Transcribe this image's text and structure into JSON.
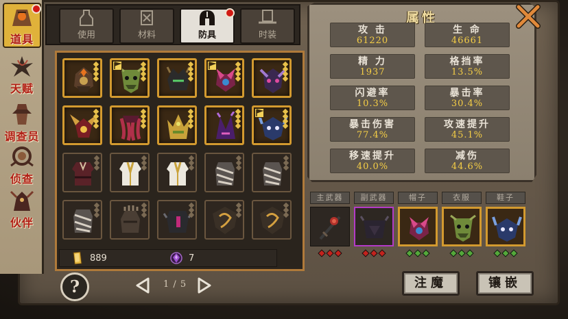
{
  "side_nav": [
    {
      "key": "props",
      "label": "道具",
      "active": true,
      "badge": true
    },
    {
      "key": "talent",
      "label": "天赋",
      "active": false,
      "badge": false
    },
    {
      "key": "investigator",
      "label": "调查员",
      "active": false,
      "badge": false
    },
    {
      "key": "detective",
      "label": "侦查",
      "active": false,
      "badge": false
    },
    {
      "key": "partner",
      "label": "伙伴",
      "active": false,
      "badge": false
    }
  ],
  "tabs": [
    {
      "key": "use",
      "label": "使用",
      "active": false,
      "badge": false
    },
    {
      "key": "material",
      "label": "材料",
      "active": false,
      "badge": false
    },
    {
      "key": "armor",
      "label": "防具",
      "active": true,
      "badge": true
    },
    {
      "key": "fashion",
      "label": "时装",
      "active": false,
      "badge": false
    }
  ],
  "inventory": [
    {
      "frame": "gold",
      "art": "flame-helm",
      "flag": false,
      "stars": 4
    },
    {
      "frame": "gold",
      "art": "green-mask",
      "flag": true,
      "stars": 4
    },
    {
      "frame": "gold",
      "art": "spike-helm",
      "flag": false,
      "stars": 4
    },
    {
      "frame": "gold",
      "art": "crest-helm",
      "flag": true,
      "stars": 4
    },
    {
      "frame": "gold",
      "art": "purple-demon",
      "flag": false,
      "stars": 4
    },
    {
      "frame": "gold",
      "art": "horned-red",
      "flag": false,
      "stars": 4
    },
    {
      "frame": "gold",
      "art": "tentacle-red",
      "flag": false,
      "stars": 4
    },
    {
      "frame": "gold",
      "art": "gold-crown",
      "flag": false,
      "stars": 4
    },
    {
      "frame": "gold",
      "art": "purple-claw",
      "flag": false,
      "stars": 4
    },
    {
      "frame": "gold",
      "art": "blue-beast",
      "flag": true,
      "stars": 4
    },
    {
      "frame": "brown",
      "art": "red-robe",
      "flag": false,
      "stars": 3
    },
    {
      "frame": "brown",
      "art": "white-robe",
      "flag": false,
      "stars": 3
    },
    {
      "frame": "brown",
      "art": "white-robe",
      "flag": false,
      "stars": 3
    },
    {
      "frame": "brown",
      "art": "strap-vest",
      "flag": false,
      "stars": 3
    },
    {
      "frame": "brown",
      "art": "strap-vest",
      "flag": false,
      "stars": 3
    },
    {
      "frame": "brown",
      "art": "strap-vest",
      "flag": false,
      "stars": 3
    },
    {
      "frame": "brown",
      "art": "dark-gauntlet",
      "flag": false,
      "stars": 3
    },
    {
      "frame": "brown",
      "art": "black-armor",
      "flag": false,
      "stars": 3
    },
    {
      "frame": "brown",
      "art": "gold-shield",
      "flag": false,
      "stars": 3
    },
    {
      "frame": "brown",
      "art": "gold-shield",
      "flag": false,
      "stars": 3
    }
  ],
  "currency": {
    "gold_icon": "gold-bar-icon",
    "gold_amount": "889",
    "gem_icon": "purple-gem-icon",
    "gem_amount": "7"
  },
  "pagination": {
    "help_label": "?",
    "page_text": "1 / 5",
    "current": 1,
    "total": 5
  },
  "attributes": {
    "title": "属性",
    "stats": [
      {
        "label": "攻  击",
        "value": "61220"
      },
      {
        "label": "生  命",
        "value": "46661"
      },
      {
        "label": "精  力",
        "value": "1937"
      },
      {
        "label": "格挡率",
        "value": "13.5%"
      },
      {
        "label": "闪避率",
        "value": "10.3%"
      },
      {
        "label": "暴击率",
        "value": "30.4%"
      },
      {
        "label": "暴击伤害",
        "value": "77.4%"
      },
      {
        "label": "攻速提升",
        "value": "45.1%"
      },
      {
        "label": "移速提升",
        "value": "40.0%"
      },
      {
        "label": "减伤",
        "value": "44.6%"
      }
    ]
  },
  "equipped": [
    {
      "label": "主武器",
      "frame": "dark",
      "art": "main-weapon",
      "gems": [
        "red",
        "red",
        "red"
      ]
    },
    {
      "label": "副武器",
      "frame": "purple",
      "art": "sub-weapon",
      "gems": [
        "red",
        "red",
        "red"
      ]
    },
    {
      "label": "帽子",
      "frame": "gold",
      "art": "crest-helm",
      "gems": [
        "green",
        "green",
        "green"
      ]
    },
    {
      "label": "衣服",
      "frame": "gold",
      "art": "green-mask",
      "gems": [
        "green",
        "green",
        "green"
      ]
    },
    {
      "label": "鞋子",
      "frame": "gold",
      "art": "blue-beast",
      "gems": [
        "green",
        "green",
        "green"
      ]
    }
  ],
  "actions": {
    "enchant": "注魔",
    "inlay": "镶嵌"
  },
  "colors": {
    "accent_gold": "#d39a2f",
    "stat_value": "#f5ce46",
    "nav_label_red": "#b01d14",
    "badge_red": "#d11a14"
  }
}
